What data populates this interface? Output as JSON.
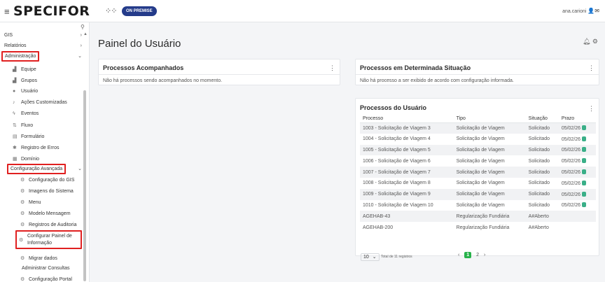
{
  "header": {
    "logo": "SPECIFOR",
    "logo_mark": "⁘⁘",
    "edition_badge": "ON PREMISE",
    "username": "ana.carioni"
  },
  "sidebar": {
    "items": [
      {
        "label": "GIS",
        "icon": "",
        "chevron": "›"
      },
      {
        "label": "Relatórios",
        "icon": "",
        "chevron": "›"
      },
      {
        "label": "Administração",
        "icon": "",
        "chevron": "⌄"
      },
      {
        "label": "Equipe",
        "icon": "team-icon"
      },
      {
        "label": "Grupos",
        "icon": "groups-icon"
      },
      {
        "label": "Usuário",
        "icon": "user-icon"
      },
      {
        "label": "Ações Customizadas",
        "icon": "actions-icon"
      },
      {
        "label": "Eventos",
        "icon": "events-icon"
      },
      {
        "label": "Fluxo",
        "icon": "flow-icon"
      },
      {
        "label": "Formulário",
        "icon": "form-icon"
      },
      {
        "label": "Registro de Erros",
        "icon": "bug-icon"
      },
      {
        "label": "Domínio",
        "icon": "domain-icon"
      },
      {
        "label": "Configuração Avançada",
        "icon": "",
        "chevron": "⌄"
      },
      {
        "label": "Configuração do GIS",
        "icon": "config-icon"
      },
      {
        "label": "Imagens do Sistema",
        "icon": "config-icon"
      },
      {
        "label": "Menu",
        "icon": "config-icon"
      },
      {
        "label": "Modelo Mensagem",
        "icon": "config-icon"
      },
      {
        "label": "Registros de Auditoria",
        "icon": "config-icon"
      },
      {
        "label": "Configurar Painel de",
        "label2": "Informação",
        "icon": "config-icon"
      },
      {
        "label": "Migrar dados",
        "icon": "config-icon"
      },
      {
        "label": "Administrar Consultas",
        "icon": ""
      },
      {
        "label": "Configuração Portal",
        "icon": "config-icon"
      }
    ]
  },
  "main": {
    "title": "Painel do Usuário",
    "acompanhados": {
      "title": "Processos Acompanhados",
      "message": "Não há processos sendo acompanhados no momento."
    },
    "situacao": {
      "title": "Processos em Determinada Situação",
      "message": "Não há processo a ser exibido de acordo com configuração informada."
    },
    "usuario": {
      "title": "Processos do Usuário",
      "columns": [
        "Processo",
        "Tipo",
        "Situação",
        "Prazo"
      ],
      "rows": [
        {
          "processo": "1003 - Solicitação de Viagem 3",
          "tipo": "Solicitação de Viagem",
          "situacao": "Solicitado",
          "prazo": "05/02/26"
        },
        {
          "processo": "1004 - Solicitação de Viagem 4",
          "tipo": "Solicitação de Viagem",
          "situacao": "Solicitado",
          "prazo": "05/02/26"
        },
        {
          "processo": "1005 - Solicitação de Viagem 5",
          "tipo": "Solicitação de Viagem",
          "situacao": "Solicitado",
          "prazo": "05/02/26"
        },
        {
          "processo": "1006 - Solicitação de Viagem 6",
          "tipo": "Solicitação de Viagem",
          "situacao": "Solicitado",
          "prazo": "05/02/26"
        },
        {
          "processo": "1007 - Solicitação de Viagem 7",
          "tipo": "Solicitação de Viagem",
          "situacao": "Solicitado",
          "prazo": "05/02/26"
        },
        {
          "processo": "1008 - Solicitação de Viagem 8",
          "tipo": "Solicitação de Viagem",
          "situacao": "Solicitado",
          "prazo": "05/02/26"
        },
        {
          "processo": "1009 - Solicitação de Viagem 9",
          "tipo": "Solicitação de Viagem",
          "situacao": "Solicitado",
          "prazo": "05/02/26"
        },
        {
          "processo": "1010 - Solicitação de Viagem 10",
          "tipo": "Solicitação de Viagem",
          "situacao": "Solicitado",
          "prazo": "05/02/26"
        },
        {
          "processo": "AGEHAB-43",
          "tipo": "Regularização Fundiária",
          "situacao": "A#Aberto",
          "prazo": ""
        },
        {
          "processo": "AGEHAB-200",
          "tipo": "Regularização Fundiária",
          "situacao": "A#Aberto",
          "prazo": ""
        }
      ],
      "page_size": "10",
      "total_label": "Total de 11 registros",
      "pages": [
        "1",
        "2"
      ],
      "current_page": "1"
    }
  },
  "colors": {
    "highlight": "#e02020",
    "badge": "#243b8a",
    "accent_green": "#27b24a",
    "status_dot": "#3aaf88"
  }
}
